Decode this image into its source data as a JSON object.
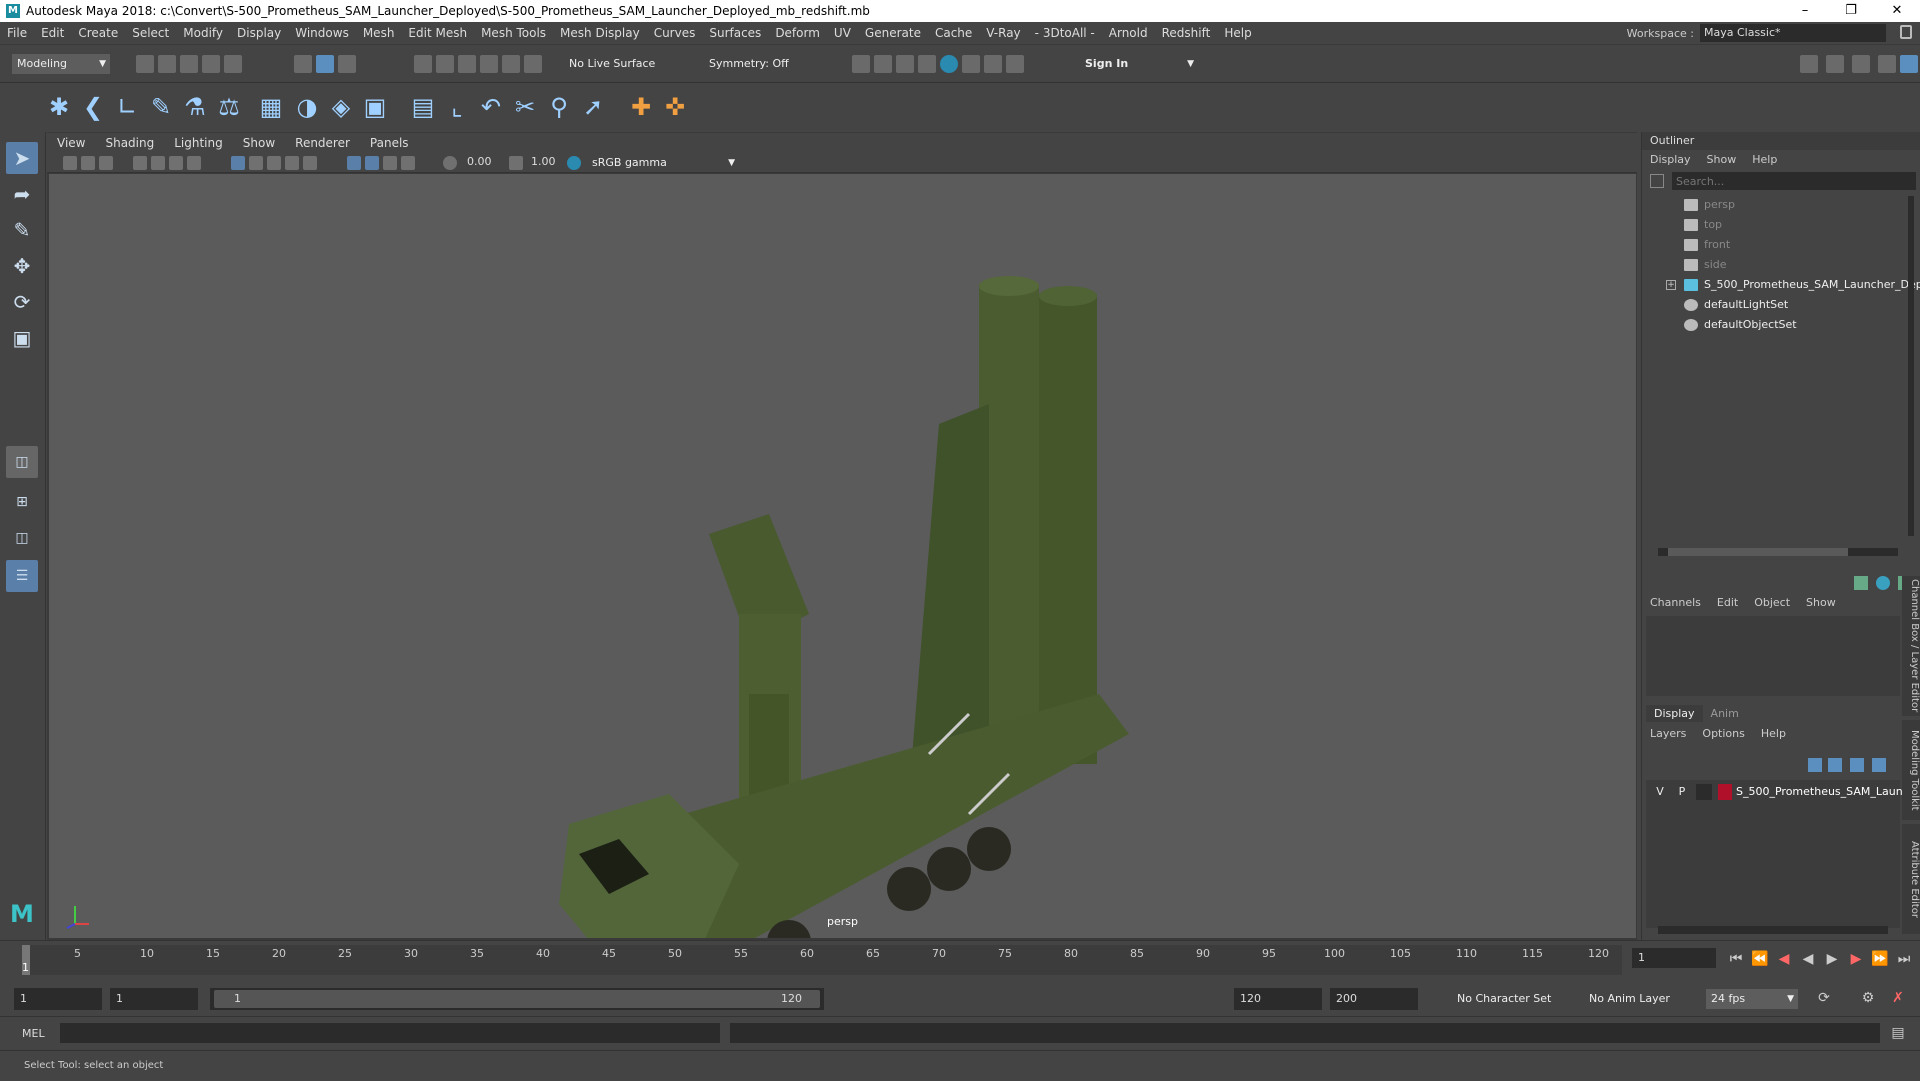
{
  "title": "Autodesk Maya 2018: c:\\Convert\\S-500_Prometheus_SAM_Launcher_Deployed\\S-500_Prometheus_SAM_Launcher_Deployed_mb_redshift.mb",
  "menu": [
    "File",
    "Edit",
    "Create",
    "Select",
    "Modify",
    "Display",
    "Windows",
    "Mesh",
    "Edit Mesh",
    "Mesh Tools",
    "Mesh Display",
    "Curves",
    "Surfaces",
    "Deform",
    "UV",
    "Generate",
    "Cache",
    "V-Ray",
    "- 3DtoAll -",
    "Arnold",
    "Redshift",
    "Help"
  ],
  "workspace": {
    "label": "Workspace :",
    "value": "Maya Classic*"
  },
  "status": {
    "mode": "Modeling",
    "live_surface": "No Live Surface",
    "symmetry": "Symmetry: Off",
    "sign_in": "Sign In"
  },
  "viewport": {
    "menu": [
      "View",
      "Shading",
      "Lighting",
      "Show",
      "Renderer",
      "Panels"
    ],
    "exposure": "0.00",
    "gamma": "1.00",
    "colorspace": "sRGB gamma",
    "camera_label": "persp"
  },
  "outliner": {
    "title": "Outliner",
    "menu": [
      "Display",
      "Show",
      "Help"
    ],
    "search_placeholder": "Search...",
    "items": [
      {
        "label": "persp",
        "dim": true
      },
      {
        "label": "top",
        "dim": true
      },
      {
        "label": "front",
        "dim": true
      },
      {
        "label": "side",
        "dim": true
      },
      {
        "label": "S_500_Prometheus_SAM_Launcher_Depl",
        "dim": false
      },
      {
        "label": "defaultLightSet",
        "dim": false
      },
      {
        "label": "defaultObjectSet",
        "dim": false
      }
    ]
  },
  "channel_box": {
    "menu": [
      "Channels",
      "Edit",
      "Object",
      "Show"
    ]
  },
  "layer_editor": {
    "tabs": [
      "Display",
      "Anim"
    ],
    "menu": [
      "Layers",
      "Options",
      "Help"
    ],
    "layer": {
      "v": "V",
      "p": "P",
      "name": "S_500_Prometheus_SAM_Launc",
      "color": "#b0102a"
    }
  },
  "side_tabs": [
    "Channel Box / Layer Editor",
    "Modeling Toolkit",
    "Attribute Editor"
  ],
  "timeline": {
    "ticks": [
      "5",
      "10",
      "15",
      "20",
      "25",
      "30",
      "35",
      "40",
      "45",
      "50",
      "55",
      "60",
      "65",
      "70",
      "75",
      "80",
      "85",
      "90",
      "95",
      "100",
      "105",
      "110",
      "115",
      "120"
    ],
    "start": "1",
    "current": "1"
  },
  "range": {
    "start": "1",
    "inner_start": "1",
    "slider_start": "1",
    "slider_end": "120",
    "end": "120",
    "max": "200",
    "char_set": "No Character Set",
    "anim_layer": "No Anim Layer",
    "fps": "24 fps"
  },
  "mel": {
    "label": "MEL"
  },
  "help_line": "Select Tool: select an object"
}
